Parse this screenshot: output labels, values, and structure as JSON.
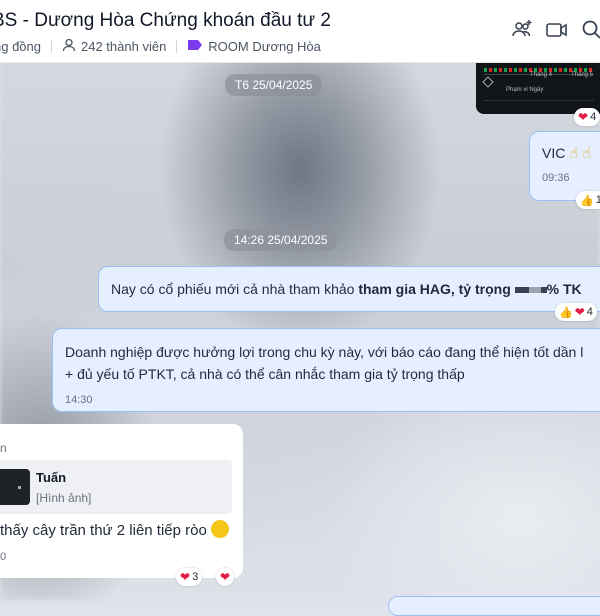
{
  "header": {
    "title": "BS - Dương Hòa Chứng khoán đầu tư 2",
    "community_label": "ng đồng",
    "members": "242 thành viên",
    "tag": "ROOM Dương Hòa"
  },
  "chart_thumb": {
    "month_labels": [
      "Tháng 4",
      "Tháng 5"
    ],
    "range_label": "Phạm vi Ngày",
    "reaction_count": "4"
  },
  "messages": {
    "vic": {
      "text": "VIC",
      "time": "09:36",
      "reaction_count": "1"
    },
    "date_pill_1": "T6 25/04/2025",
    "date_pill_2": "14:26 25/04/2025",
    "hag": {
      "prefix": "Nay có cổ phiếu mới cả nhà tham khảo ",
      "bold": "tham gia HAG, tỷ trọng ",
      "suffix": "% TK",
      "reaction_count": "4"
    },
    "dn": {
      "line1": "Doanh nghiệp được hưởng lợi trong chu kỳ này, với báo cáo đang thể hiện tốt dần l",
      "line2": "+ đủ yếu tố PTKT, cả nhà có thể cân nhắc tham gia tỷ trọng thấp",
      "time": "14:30"
    },
    "reply": {
      "sender": "n",
      "quote_name": "Tuấn",
      "quote_text": "[Hình ảnh]",
      "text": "thấy cây trần thứ 2 liên tiếp ròo",
      "time": "0",
      "reaction_count": "3"
    }
  },
  "colors": {
    "accent": "#7c3aed",
    "bubble_bg": "#e5efff",
    "bubble_border": "#9cc0f5",
    "heart": "#e11d48"
  }
}
